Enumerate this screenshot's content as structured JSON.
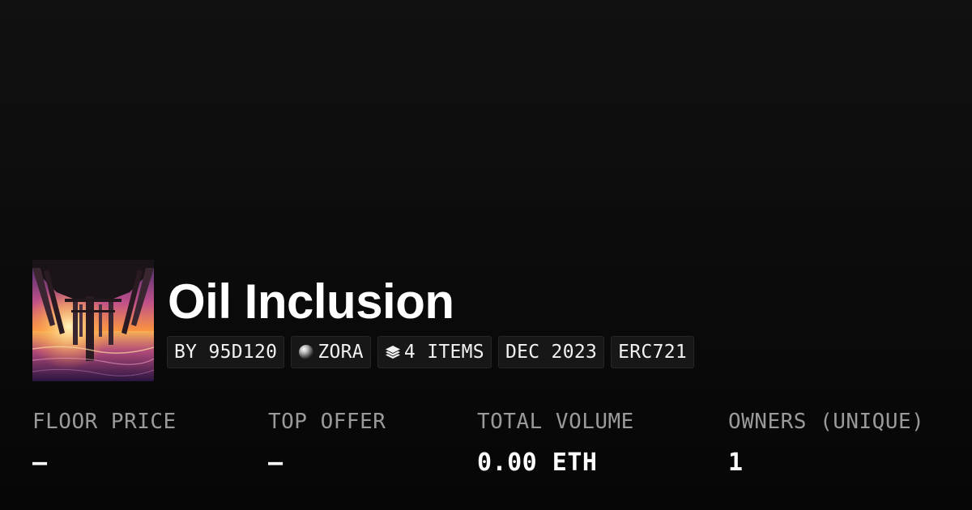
{
  "collection": {
    "title": "Oil Inclusion",
    "thumbnail_icon": "pier-sunset-image"
  },
  "tags": [
    {
      "label": "BY 95D120",
      "icon": null
    },
    {
      "label": "ZORA",
      "icon": "zora-orb-icon"
    },
    {
      "label": "4 ITEMS",
      "icon": "layers-icon"
    },
    {
      "label": "DEC 2023",
      "icon": null
    },
    {
      "label": "ERC721",
      "icon": null
    }
  ],
  "stats": [
    {
      "label": "FLOOR PRICE",
      "value": "–"
    },
    {
      "label": "TOP OFFER",
      "value": "–"
    },
    {
      "label": "TOTAL VOLUME",
      "value": "0.00 ETH"
    },
    {
      "label": "OWNERS (UNIQUE)",
      "value": "1"
    }
  ],
  "colors": {
    "background": "#0b0b0b",
    "tag_background": "#171717",
    "label_gray": "#9a9a9a",
    "text": "#ffffff"
  }
}
